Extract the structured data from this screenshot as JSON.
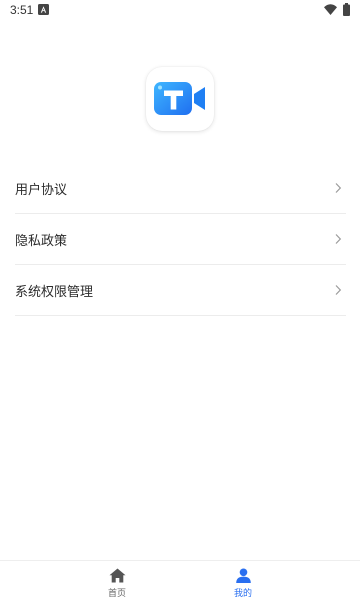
{
  "status_bar": {
    "time": "3:51",
    "notification_icon": "a-notification-icon",
    "wifi_icon": "wifi-icon",
    "battery_icon": "battery-icon"
  },
  "app": {
    "logo_icon": "video-camera-t-logo",
    "logo_letter": "T",
    "brand_color": "#2a8ef7"
  },
  "menu": {
    "items": [
      {
        "label": "用户协议",
        "icon": "chevron-right-icon"
      },
      {
        "label": "隐私政策",
        "icon": "chevron-right-icon"
      },
      {
        "label": "系统权限管理",
        "icon": "chevron-right-icon"
      }
    ]
  },
  "tab_bar": {
    "tabs": [
      {
        "label": "首页",
        "icon": "home-icon",
        "active": false
      },
      {
        "label": "我的",
        "icon": "user-icon",
        "active": true
      }
    ],
    "active_color": "#2a6ff0",
    "inactive_color": "#666666"
  }
}
